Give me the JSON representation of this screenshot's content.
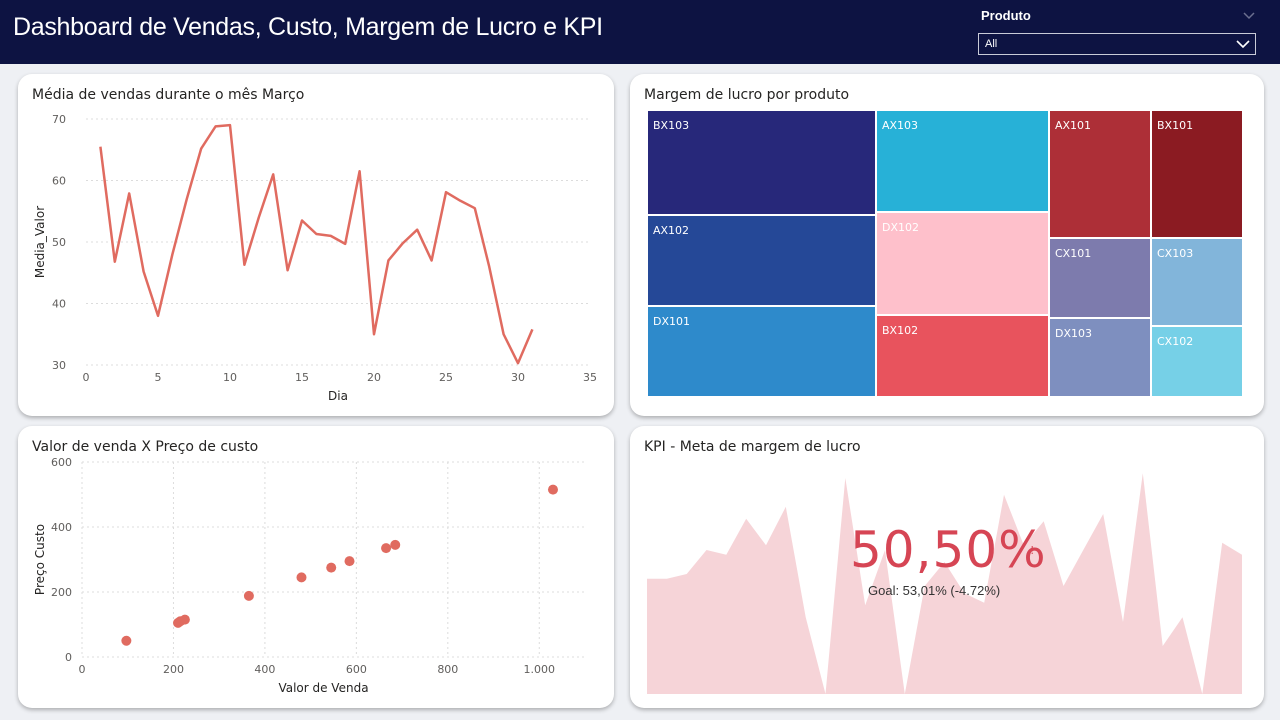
{
  "header": {
    "title": "Dashboard de Vendas, Custo, Margem de Lucro e KPI"
  },
  "slicer": {
    "label": "Produto",
    "value": "All"
  },
  "colors": {
    "header_bg": "#0d1342",
    "line": "#e06b60",
    "kpi_value": "#d64554",
    "kpi_area": "#f6d4d8"
  },
  "line_card": {
    "title": "Média de vendas durante o mês Março",
    "chart_data": {
      "type": "line",
      "xlabel": "Dia",
      "ylabel": "Media_Valor",
      "xlim": [
        0,
        35
      ],
      "ylim": [
        30,
        70
      ],
      "xticks": [
        "0",
        "5",
        "10",
        "15",
        "20",
        "25",
        "30",
        "35"
      ],
      "yticks": [
        "30",
        "40",
        "50",
        "60",
        "70"
      ],
      "x": [
        1,
        2,
        3,
        4,
        5,
        6,
        7,
        8,
        9,
        10,
        11,
        12,
        13,
        14,
        15,
        16,
        17,
        18,
        19,
        20,
        21,
        22,
        23,
        24,
        25,
        26,
        27,
        28,
        29,
        30,
        31
      ],
      "y": [
        65.5,
        46.8,
        57.9,
        45.2,
        38.0,
        48.0,
        57.0,
        65.2,
        68.8,
        69.0,
        46.3,
        54.0,
        61.0,
        45.4,
        53.5,
        51.3,
        51.0,
        49.7,
        61.5,
        35.0,
        47.0,
        49.8,
        52.0,
        47.0,
        58.1,
        56.7,
        55.5,
        46.0,
        35.0,
        30.3,
        35.8
      ]
    }
  },
  "treemap_card": {
    "title": "Margem de lucro por produto",
    "chart_data": {
      "type": "treemap",
      "items": [
        {
          "name": "BX103",
          "color": "#27287a",
          "label_color": "#ffffff"
        },
        {
          "name": "AX102",
          "color": "#254897",
          "label_color": "#ffffff"
        },
        {
          "name": "DX101",
          "color": "#2e8acb",
          "label_color": "#ffffff"
        },
        {
          "name": "AX103",
          "color": "#27b1d7",
          "label_color": "#ffffff"
        },
        {
          "name": "DX102",
          "color": "#fec0cb",
          "label_color": "#ffffff"
        },
        {
          "name": "BX102",
          "color": "#e8535d",
          "label_color": "#ffffff"
        },
        {
          "name": "AX101",
          "color": "#ad2f37",
          "label_color": "#ffffff"
        },
        {
          "name": "CX101",
          "color": "#7d7bad",
          "label_color": "#ffffff"
        },
        {
          "name": "DX103",
          "color": "#7e8fbf",
          "label_color": "#ffffff"
        },
        {
          "name": "BX101",
          "color": "#8b1b22",
          "label_color": "#ffffff"
        },
        {
          "name": "CX103",
          "color": "#82b5da",
          "label_color": "#ffffff"
        },
        {
          "name": "CX102",
          "color": "#76d0e7",
          "label_color": "#ffffff"
        }
      ]
    }
  },
  "scatter_card": {
    "title": "Valor de venda X Preço de custo",
    "chart_data": {
      "type": "scatter",
      "xlabel": "Valor de Venda",
      "ylabel": "Preço Custo",
      "xlim": [
        0,
        1100
      ],
      "ylim": [
        0,
        600
      ],
      "xticks": [
        "0",
        "200",
        "400",
        "600",
        "800",
        "1.000"
      ],
      "yticks": [
        "0",
        "200",
        "400",
        "600"
      ],
      "points": [
        [
          97,
          50
        ],
        [
          210,
          105
        ],
        [
          215,
          110
        ],
        [
          225,
          115
        ],
        [
          365,
          188
        ],
        [
          480,
          245
        ],
        [
          545,
          275
        ],
        [
          585,
          295
        ],
        [
          665,
          335
        ],
        [
          685,
          345
        ],
        [
          1030,
          515
        ]
      ]
    }
  },
  "kpi_card": {
    "title": "KPI - Meta de margem de lucro",
    "value": "50,50%",
    "indicator": "!",
    "goal": "Goal: 53,01% (-4.72%)",
    "chart_data": {
      "type": "area",
      "y": [
        48,
        48,
        50,
        60,
        58,
        73,
        62,
        78,
        32,
        0,
        90,
        37,
        60,
        0,
        45,
        55,
        42,
        38,
        83,
        62,
        72,
        45,
        60,
        75,
        30,
        92,
        20,
        32,
        0,
        63,
        58
      ]
    }
  }
}
